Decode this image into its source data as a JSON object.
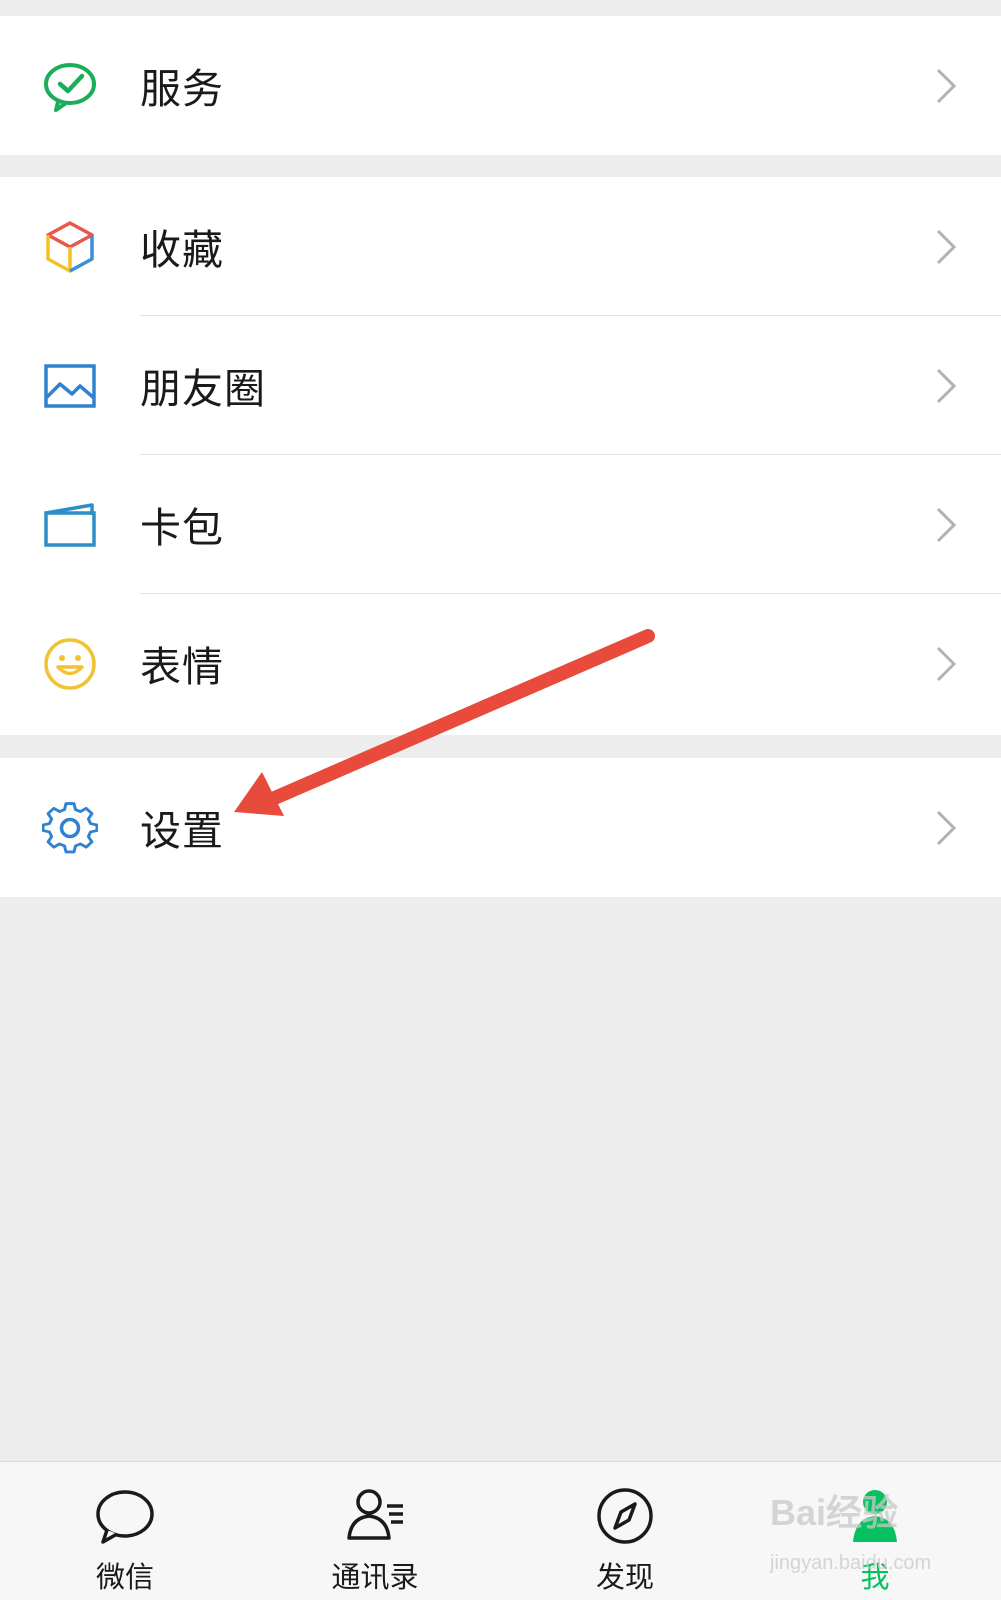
{
  "menu": {
    "service": {
      "label": "服务",
      "icon": "service-check-icon"
    },
    "favorites": {
      "label": "收藏",
      "icon": "cube-icon"
    },
    "moments": {
      "label": "朋友圈",
      "icon": "picture-icon"
    },
    "cards": {
      "label": "卡包",
      "icon": "wallet-icon"
    },
    "stickers": {
      "label": "表情",
      "icon": "smiley-icon"
    },
    "settings": {
      "label": "设置",
      "icon": "gear-icon"
    }
  },
  "tabs": [
    {
      "label": "微信",
      "icon": "chat-bubble-icon",
      "active": false
    },
    {
      "label": "通讯录",
      "icon": "contacts-icon",
      "active": false
    },
    {
      "label": "发现",
      "icon": "compass-icon",
      "active": false
    },
    {
      "label": "我",
      "icon": "person-icon",
      "active": true
    }
  ],
  "watermark": {
    "brand": "Bai经验",
    "url": "jingyan.baidu.com"
  },
  "colors": {
    "accent": "#07c160",
    "annotation_arrow": "#e84a3c",
    "background": "#ededed"
  }
}
